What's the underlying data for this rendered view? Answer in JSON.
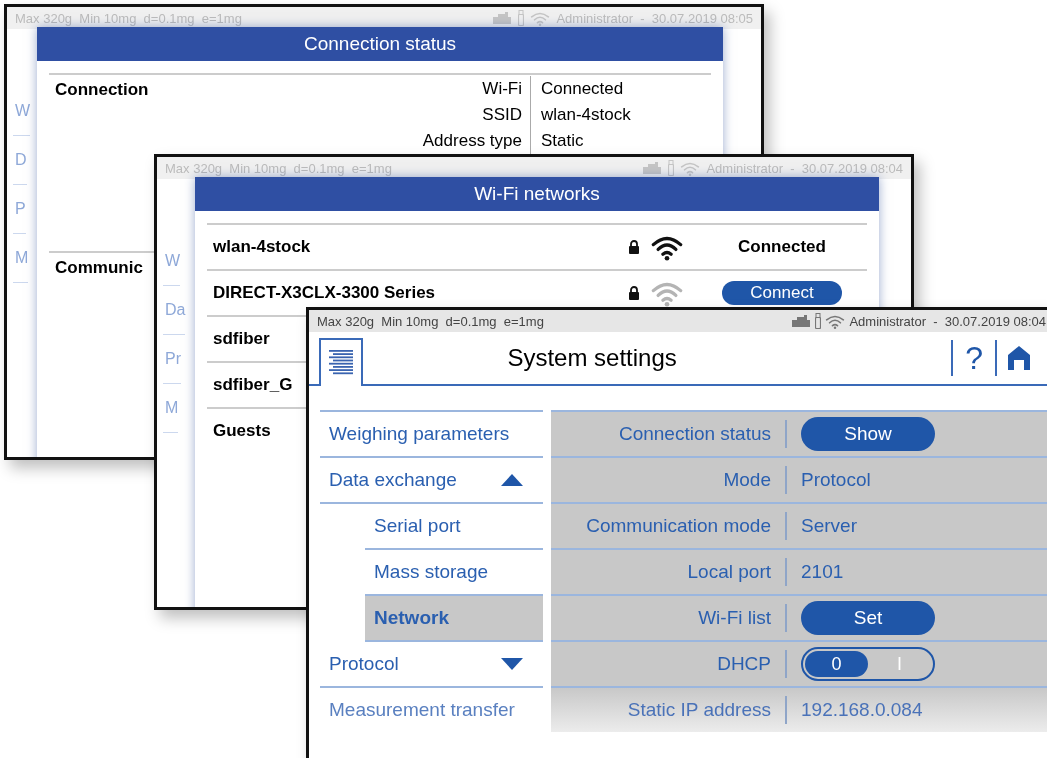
{
  "connection_status_screen": {
    "status_bar": {
      "info": "Max 320g  Min 10mg  d=0.1mg  e=1mg",
      "user_time": "Administrator  -  30.07.2019 08:05"
    },
    "background_nav": [
      "W",
      "D",
      "P",
      "M"
    ],
    "dialog": {
      "title": "Connection status",
      "sections": [
        {
          "heading": "Connection",
          "rows": [
            {
              "label": "Wi-Fi",
              "value": "Connected"
            },
            {
              "label": "SSID",
              "value": "wlan-4stock"
            },
            {
              "label": "Address type",
              "value": "Static"
            }
          ]
        },
        {
          "heading": "Communic"
        }
      ]
    }
  },
  "wifi_networks_screen": {
    "status_bar": {
      "info": "Max 320g  Min 10mg  d=0.1mg  e=1mg",
      "user_time": "Administrator  -  30.07.2019 08:04"
    },
    "background_nav": [
      "W",
      "Da",
      "Pr",
      "M"
    ],
    "dialog": {
      "title": "Wi-Fi networks",
      "networks": [
        {
          "name": "wlan-4stock",
          "locked": true,
          "available": true,
          "status": {
            "kind": "text",
            "label": "Connected"
          }
        },
        {
          "name": "DIRECT-X3CLX-3300 Series",
          "locked": true,
          "available": false,
          "status": {
            "kind": "button",
            "label": "Connect"
          }
        },
        {
          "name": "sdfiber"
        },
        {
          "name": "sdfiber_G"
        },
        {
          "name": "Guests"
        }
      ]
    }
  },
  "system_settings_screen": {
    "status_bar": {
      "info": "Max 320g  Min 10mg  d=0.1mg  e=1mg",
      "user_time": "Administrator  -  30.07.2019 08:04"
    },
    "title": "System settings",
    "help": "?",
    "nav": [
      {
        "label": "Weighing parameters",
        "kind": "item",
        "selected": false
      },
      {
        "label": "Data exchange",
        "kind": "group",
        "expanded": true,
        "selected": false
      },
      {
        "label": "Serial port",
        "kind": "subitem",
        "selected": false
      },
      {
        "label": "Mass storage",
        "kind": "subitem",
        "selected": false
      },
      {
        "label": "Network",
        "kind": "subitem",
        "selected": true
      },
      {
        "label": "Protocol",
        "kind": "group",
        "expanded": false,
        "selected": false
      },
      {
        "label": "Measurement transfer",
        "kind": "item",
        "selected": false
      }
    ],
    "settings": [
      {
        "label": "Connection status",
        "kind": "button",
        "value": "Show"
      },
      {
        "label": "Mode",
        "kind": "text",
        "value": "Protocol"
      },
      {
        "label": "Communication mode",
        "kind": "text",
        "value": "Server"
      },
      {
        "label": "Local port",
        "kind": "text",
        "value": "2101"
      },
      {
        "label": "Wi-Fi list",
        "kind": "button",
        "value": "Set"
      },
      {
        "label": "DHCP",
        "kind": "toggle",
        "off_label": "0",
        "on_label": "I",
        "on": false
      },
      {
        "label": "Static IP address",
        "kind": "text",
        "value": "192.168.0.084"
      }
    ]
  }
}
